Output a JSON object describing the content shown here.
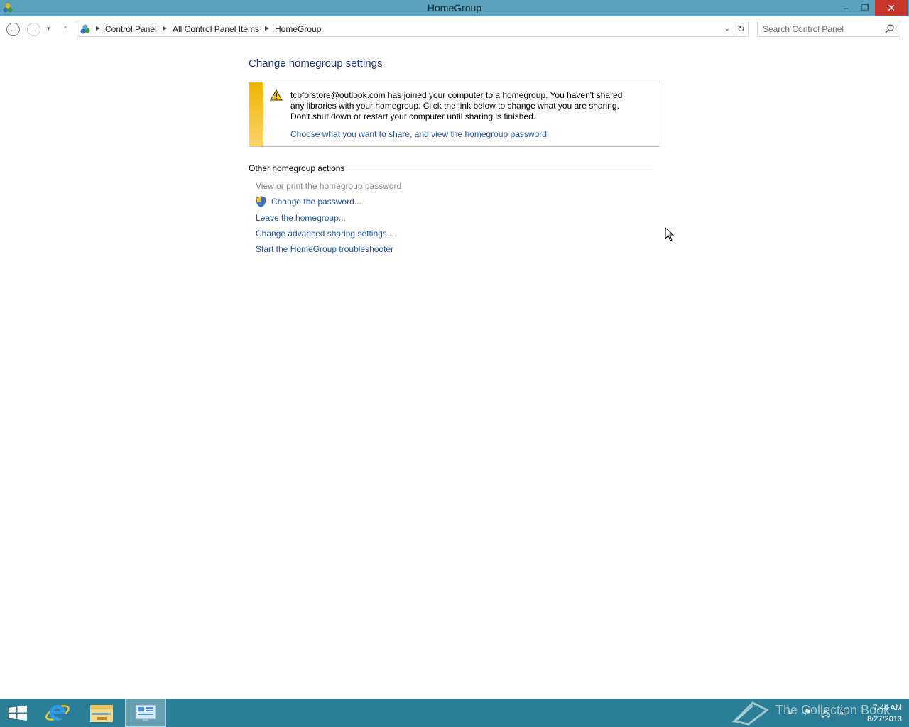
{
  "window": {
    "title": "HomeGroup",
    "minimize_glyph": "–",
    "maximize_glyph": "❐",
    "close_glyph": "✕"
  },
  "navigation": {
    "back_glyph": "←",
    "forward_glyph": "→",
    "recent_glyph": "▾",
    "up_glyph": "↑",
    "breadcrumbs": [
      "Control Panel",
      "All Control Panel Items",
      "HomeGroup"
    ],
    "separator_glyph": "▶",
    "dropdown_glyph": "⌄",
    "refresh_glyph": "↻"
  },
  "search": {
    "placeholder": "Search Control Panel",
    "icon": "magnifier-icon"
  },
  "main": {
    "heading": "Change homegroup settings",
    "notice": {
      "icon": "warning-icon",
      "message": "tcbforstore@outlook.com has joined your computer to a homegroup. You haven't shared any libraries with your homegroup. Click the link below to change what you are sharing. Don't shut down or restart your computer until sharing is finished.",
      "link": "Choose what you want to share, and view the homegroup password",
      "accent_color": "#f0b400"
    },
    "other_actions": {
      "title": "Other homegroup actions",
      "items": [
        {
          "label": "View or print the homegroup password",
          "enabled": false
        },
        {
          "label": "Change the password...",
          "enabled": true,
          "icon": "uac-shield-icon"
        },
        {
          "label": "Leave the homegroup...",
          "enabled": true
        },
        {
          "label": "Change advanced sharing settings...",
          "enabled": true
        },
        {
          "label": "Start the HomeGroup troubleshooter",
          "enabled": true
        }
      ]
    }
  },
  "taskbar": {
    "items": [
      "start-button",
      "internet-explorer",
      "file-explorer",
      "control-panel"
    ],
    "watermark": "The Collection Book",
    "clock": {
      "time": "7:44 AM",
      "date": "8/27/2013"
    },
    "tray_icons": [
      "show-hidden-icons",
      "action-center-flag",
      "network-icon",
      "volume-icon"
    ],
    "colors": {
      "taskbar": "#2b7e96",
      "titlebar": "#5aa2bb",
      "link": "#1f56b5",
      "heading": "#1e3287"
    }
  }
}
